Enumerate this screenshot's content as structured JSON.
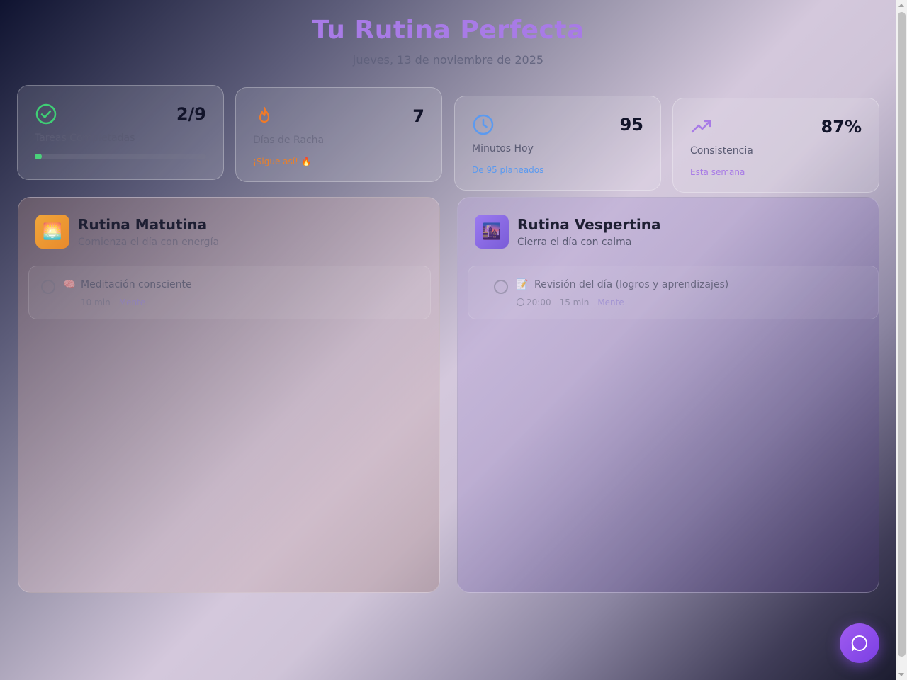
{
  "header": {
    "title": "Tu Rutina Perfecta",
    "date": "jueves, 13 de noviembre de 2025"
  },
  "stats": [
    {
      "value": "2/9",
      "label": "Tareas Completadas",
      "icon": "check-circle-icon",
      "color": "#3fcf75",
      "progress": 0.04
    },
    {
      "value": "7",
      "label": "Días de Racha",
      "note": "¡Sigue así! 🔥",
      "icon": "flame-icon",
      "color": "#f07a28"
    },
    {
      "value": "95",
      "label": "Minutos Hoy",
      "note": "De 95 planeados",
      "icon": "clock-icon",
      "color": "#5b9af0"
    },
    {
      "value": "87%",
      "label": "Consistencia",
      "note": "Esta semana",
      "icon": "trending-up-icon",
      "color": "#a87be6"
    }
  ],
  "routines": {
    "morning": {
      "title": "Rutina Matutina",
      "subtitle": "Comienza el día con energía",
      "icon_emoji": "🌅",
      "tasks": [
        {
          "emoji": "🧠",
          "name": "Meditación consciente",
          "time": "",
          "duration": "10 min",
          "category": "Mente"
        }
      ]
    },
    "evening": {
      "title": "Rutina Vespertina",
      "subtitle": "Cierra el día con calma",
      "icon_emoji": "🌆",
      "tasks": [
        {
          "emoji": "📝",
          "name": "Revisión del día (logros y aprendizajes)",
          "time": "20:00",
          "duration": "15 min",
          "category": "Mente"
        }
      ]
    }
  },
  "fab": {
    "icon": "chat-bubble-icon"
  }
}
